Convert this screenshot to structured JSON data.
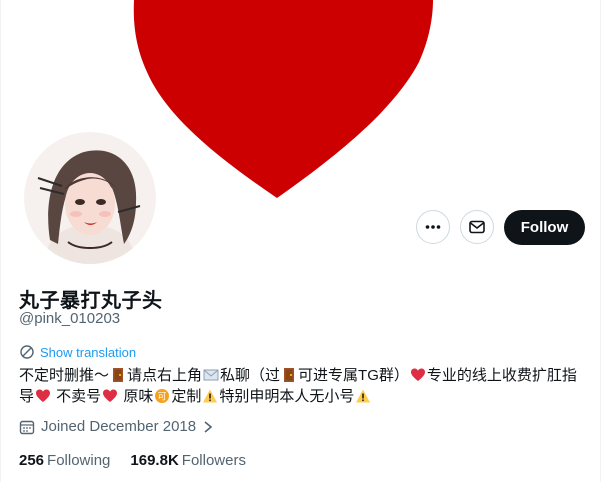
{
  "profile": {
    "display_name": "丸子暴打丸子头",
    "handle": "@pink_010203",
    "show_translation": "Show translation",
    "bio": {
      "seg1": "不定时删推～",
      "seg2": "请点右上角",
      "seg3": "私聊（过",
      "seg4": "可进专属TG群）",
      "seg5": "专业的线上收费扩肛指导",
      "seg6": " 不卖号",
      "seg7": " 原味",
      "seg8": "定制",
      "seg9": "特别申明本人无小号"
    },
    "joined": "Joined December 2018",
    "following_count": "256",
    "following_label": "Following",
    "followers_count": "169.8K",
    "followers_label": "Followers"
  },
  "actions": {
    "follow_label": "Follow",
    "more_icon": "more-horizontal-icon",
    "message_icon": "envelope-icon"
  },
  "colors": {
    "banner_heart": "#cc0000",
    "follow_bg": "#0f1419",
    "link": "#1d9bf0",
    "muted": "#536471"
  }
}
